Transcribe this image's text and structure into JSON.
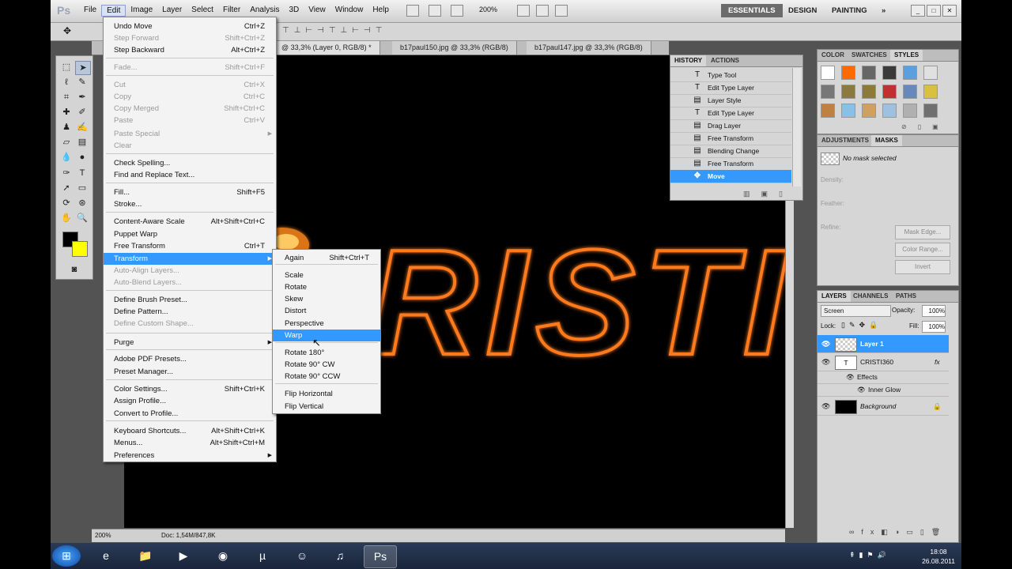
{
  "app": {
    "logo": "Ps"
  },
  "menubar": [
    "File",
    "Edit",
    "Image",
    "Layer",
    "Select",
    "Filter",
    "Analysis",
    "3D",
    "View",
    "Window",
    "Help"
  ],
  "toolbar": {
    "zoom": "200%"
  },
  "workspaces": [
    "ESSENTIALS",
    "DESIGN",
    "PAINTING",
    "»"
  ],
  "doc_tabs": [
    "b17paul150.jpg @ 33,3% (RGB/8)",
    "b17paul147.jpg @ 33,3% (RGB/8)"
  ],
  "active_tab_partial": "@ 33,3% (Layer 0, RGB/8) *",
  "edit_menu": [
    {
      "label": "Undo Move",
      "shortcut": "Ctrl+Z",
      "disabled": false
    },
    {
      "label": "Step Forward",
      "shortcut": "Shift+Ctrl+Z",
      "disabled": true
    },
    {
      "label": "Step Backward",
      "shortcut": "Alt+Ctrl+Z",
      "disabled": false
    },
    {
      "label": "Fade...",
      "shortcut": "Shift+Ctrl+F",
      "disabled": true
    },
    {
      "label": "Cut",
      "shortcut": "Ctrl+X",
      "disabled": true
    },
    {
      "label": "Copy",
      "shortcut": "Ctrl+C",
      "disabled": true
    },
    {
      "label": "Copy Merged",
      "shortcut": "Shift+Ctrl+C",
      "disabled": true
    },
    {
      "label": "Paste",
      "shortcut": "Ctrl+V",
      "disabled": true
    },
    {
      "label": "Paste Special",
      "shortcut": "",
      "disabled": true
    },
    {
      "label": "Clear",
      "shortcut": "",
      "disabled": true
    },
    {
      "label": "Check Spelling...",
      "shortcut": "",
      "disabled": false
    },
    {
      "label": "Find and Replace Text...",
      "shortcut": "",
      "disabled": false
    },
    {
      "label": "Fill...",
      "shortcut": "Shift+F5",
      "disabled": false
    },
    {
      "label": "Stroke...",
      "shortcut": "",
      "disabled": false
    },
    {
      "label": "Content-Aware Scale",
      "shortcut": "Alt+Shift+Ctrl+C",
      "disabled": false
    },
    {
      "label": "Puppet Warp",
      "shortcut": "",
      "disabled": false
    },
    {
      "label": "Free Transform",
      "shortcut": "Ctrl+T",
      "disabled": false
    },
    {
      "label": "Transform",
      "shortcut": "",
      "disabled": false
    },
    {
      "label": "Auto-Align Layers...",
      "shortcut": "",
      "disabled": true
    },
    {
      "label": "Auto-Blend Layers...",
      "shortcut": "",
      "disabled": true
    },
    {
      "label": "Define Brush Preset...",
      "shortcut": "",
      "disabled": false
    },
    {
      "label": "Define Pattern...",
      "shortcut": "",
      "disabled": false
    },
    {
      "label": "Define Custom Shape...",
      "shortcut": "",
      "disabled": true
    },
    {
      "label": "Purge",
      "shortcut": "",
      "disabled": false
    },
    {
      "label": "Adobe PDF Presets...",
      "shortcut": "",
      "disabled": false
    },
    {
      "label": "Preset Manager...",
      "shortcut": "",
      "disabled": false
    },
    {
      "label": "Color Settings...",
      "shortcut": "Shift+Ctrl+K",
      "disabled": false
    },
    {
      "label": "Assign Profile...",
      "shortcut": "",
      "disabled": false
    },
    {
      "label": "Convert to Profile...",
      "shortcut": "",
      "disabled": false
    },
    {
      "label": "Keyboard Shortcuts...",
      "shortcut": "Alt+Shift+Ctrl+K",
      "disabled": false
    },
    {
      "label": "Menus...",
      "shortcut": "Alt+Shift+Ctrl+M",
      "disabled": false
    },
    {
      "label": "Preferences",
      "shortcut": "",
      "disabled": false
    }
  ],
  "transform_submenu": [
    {
      "label": "Again",
      "shortcut": "Shift+Ctrl+T"
    },
    {
      "label": "Scale",
      "shortcut": ""
    },
    {
      "label": "Rotate",
      "shortcut": ""
    },
    {
      "label": "Skew",
      "shortcut": ""
    },
    {
      "label": "Distort",
      "shortcut": ""
    },
    {
      "label": "Perspective",
      "shortcut": ""
    },
    {
      "label": "Warp",
      "shortcut": ""
    },
    {
      "label": "Rotate 180°",
      "shortcut": ""
    },
    {
      "label": "Rotate 90° CW",
      "shortcut": ""
    },
    {
      "label": "Rotate 90° CCW",
      "shortcut": ""
    },
    {
      "label": "Flip Horizontal",
      "shortcut": ""
    },
    {
      "label": "Flip Vertical",
      "shortcut": ""
    }
  ],
  "history": {
    "tabs": [
      "HISTORY",
      "ACTIONS"
    ],
    "items": [
      "Type Tool",
      "Edit Type Layer",
      "Layer Style",
      "Edit Type Layer",
      "Drag Layer",
      "Free Transform",
      "Blending Change",
      "Free Transform",
      "Move"
    ]
  },
  "swatch_panel": {
    "tabs": [
      "COLOR",
      "SWATCHES",
      "STYLES"
    ]
  },
  "adjust_panel": {
    "tabs": [
      "ADJUSTMENTS",
      "MASKS"
    ],
    "status": "No mask selected",
    "density": "Density:",
    "feather": "Feather:",
    "refine": "Refine:",
    "buttons": [
      "Mask Edge...",
      "Color Range...",
      "Invert"
    ]
  },
  "layers_panel": {
    "tabs": [
      "LAYERS",
      "CHANNELS",
      "PATHS"
    ],
    "blend": "Screen",
    "opacity_label": "Opacity:",
    "opacity": "100%",
    "lock_label": "Lock:",
    "fill_label": "Fill:",
    "fill": "100%",
    "layers": [
      "Layer 1",
      "CRISTI360",
      "Effects",
      "Inner Glow",
      "Background"
    ]
  },
  "canvas_text": "RISTI",
  "status": {
    "zoom": "200%",
    "doc": "Doc: 1,54M/847,8K"
  },
  "clock": {
    "time": "18:08",
    "date": "26.08.2011"
  },
  "colors": {
    "accent": "#3399ff",
    "canvas": "#000000",
    "foreground": "#000000",
    "background": "#ffff00",
    "glow": "#ff7a1a"
  }
}
